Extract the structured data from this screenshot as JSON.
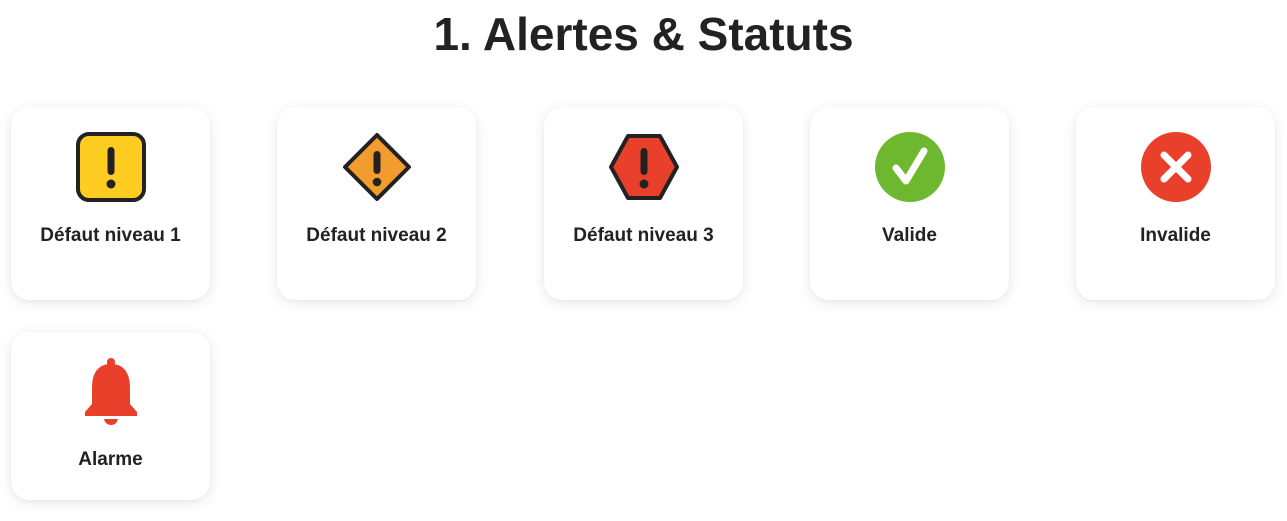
{
  "page": {
    "title": "1. Alertes & Statuts"
  },
  "colors": {
    "default_level_1": "#FFCC22",
    "default_level_2": "#F39C2E",
    "default_level_3": "#E8402A",
    "valid": "#6DB82F",
    "invalid": "#E8402A",
    "alarm": "#E8402A",
    "outline": "#222222"
  },
  "cards": [
    {
      "label": "Défaut niveau 1",
      "icon": "warning-square-icon"
    },
    {
      "label": "Défaut niveau 2",
      "icon": "warning-diamond-icon"
    },
    {
      "label": "Défaut niveau 3",
      "icon": "warning-hexagon-icon"
    },
    {
      "label": "Valide",
      "icon": "check-circle-icon"
    },
    {
      "label": "Invalide",
      "icon": "cross-circle-icon"
    },
    {
      "label": "Alarme",
      "icon": "bell-icon"
    }
  ]
}
